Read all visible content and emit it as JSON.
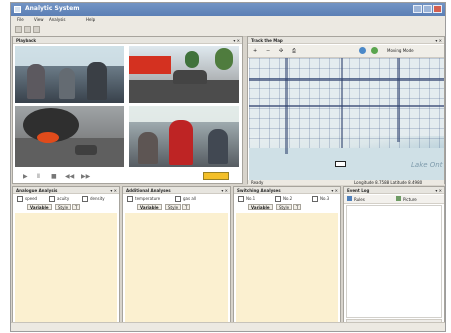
{
  "app": {
    "title": "Analytic System",
    "menu": [
      "File",
      "View",
      "Analysis",
      "Help"
    ]
  },
  "playback": {
    "title": "Playback",
    "controls": [
      "play-icon",
      "pause-icon",
      "stop-icon",
      "previous-icon",
      "next-icon"
    ]
  },
  "map": {
    "title": "Track the Map",
    "toolbar_mode": "Moving Mode",
    "status_ready": "Ready",
    "coordinates": "Longitude 8.7588  Latitude 8.4980",
    "lake_label": "Lake Ont"
  },
  "panels": {
    "analog": {
      "title": "Analogue Analysis",
      "checks": [
        "speed",
        "acuity",
        "density"
      ],
      "tab_variable": "Variable",
      "tab_style": "Style",
      "tab_t": "T"
    },
    "additional": {
      "title": "Additional Analyses",
      "checks": [
        "temperature",
        "gas all"
      ],
      "tab_variable": "Variable",
      "tab_style": "Style",
      "tab_t": "T"
    },
    "switching": {
      "title": "Switching Analyses",
      "checks": [
        "No.1",
        "No.2",
        "No.3"
      ],
      "tab_variable": "Variable",
      "tab_style": "Style",
      "tab_t": "T"
    },
    "event": {
      "title": "Event Log",
      "header_items": [
        "Rules",
        "Picture"
      ]
    }
  },
  "colors": {
    "title_bar": "#6d8fc2",
    "panel_yellow": "#fbf0d0",
    "accent_green": "#5aa54e",
    "map_water": "#cfe0e6"
  }
}
